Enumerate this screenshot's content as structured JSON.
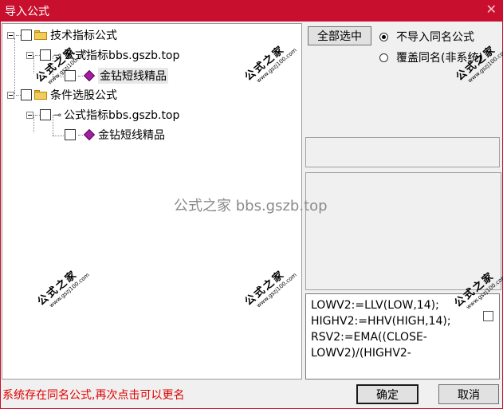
{
  "window": {
    "title": "导入公式",
    "close_glyph": "✕"
  },
  "tree": {
    "nodes": [
      {
        "label": "技术指标公式",
        "icon": "folder-icon"
      },
      {
        "label": "公式指标bbs.gszb.top",
        "icon": "key-icon"
      },
      {
        "label": "金钻短线精品",
        "icon": "gem-icon"
      },
      {
        "label": "条件选股公式",
        "icon": "folder-icon"
      },
      {
        "label": "公式指标bbs.gszb.top",
        "icon": "key-icon"
      },
      {
        "label": "金钻短线精品",
        "icon": "gem-icon"
      }
    ]
  },
  "buttons": {
    "select_all": "全部选中",
    "ok": "确定",
    "cancel": "取消"
  },
  "options": {
    "no_import_same_name": "不导入同名公式",
    "overwrite_same_name": "覆盖同名(非系统)"
  },
  "formula": {
    "lines": [
      "LOWV2:=LLV(LOW,14);",
      "HIGHV2:=HHV(HIGH,14);",
      "RSV2:=EMA((CLOSE-",
      "LOWV2)/(HIGHV2-"
    ]
  },
  "status": {
    "message": "系统存在同名公式,再次点击可以更名"
  },
  "watermarks": {
    "center": "公式之家 bbs.gszb.top",
    "stamp_cn": "公式之家",
    "stamp_url": "www.gszj100.com"
  }
}
